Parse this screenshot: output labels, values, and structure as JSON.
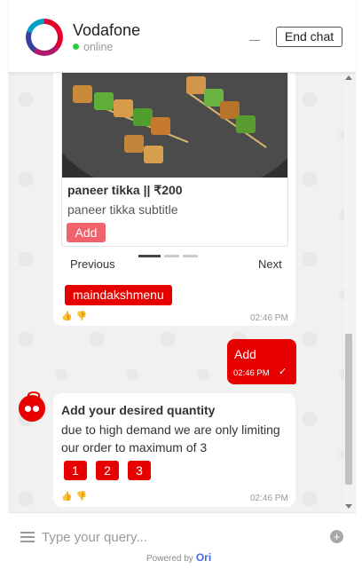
{
  "header": {
    "brand": "Vodafone",
    "status": "online",
    "end_chat_label": "End chat"
  },
  "carousel": {
    "product_title": "paneer tikka || ₹200",
    "product_subtitle": "paneer tikka subtitle",
    "add_label": "Add",
    "prev_label": "Previous",
    "next_label": "Next",
    "menu_chip": "maindakshmenu",
    "time": "02:46 PM"
  },
  "user_message": {
    "text": "Add",
    "time": "02:46 PM",
    "check": "✓"
  },
  "bot_message": {
    "title": "Add your desired quantity",
    "text": "due to high demand we are only limiting our order to maximum of 3",
    "options": [
      "1",
      "2",
      "3"
    ],
    "time": "02:46 PM"
  },
  "footer": {
    "placeholder": "Type your query...",
    "powered_by": "Powered by",
    "powered_brand": "Ori",
    "plus": "+"
  },
  "colors": {
    "accent": "#e60000",
    "add_button": "#f0626c",
    "online": "#2ecc40"
  },
  "icons": {
    "thumbs_up": "thumbs-up-icon",
    "thumbs_down": "thumbs-down-icon",
    "menu": "hamburger-menu-icon",
    "plus": "plus-circle-icon"
  }
}
